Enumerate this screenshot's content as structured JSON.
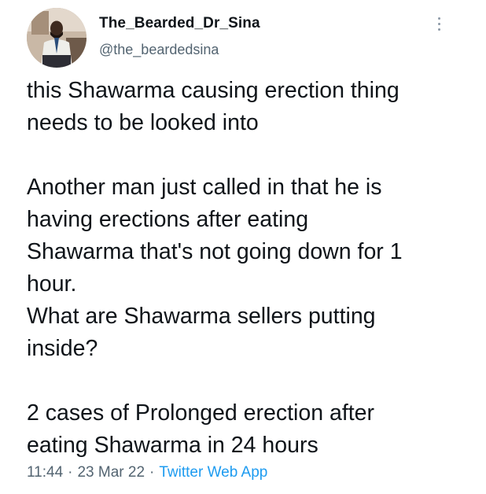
{
  "author": {
    "display_name": "The_Bearded_Dr_Sina",
    "handle": "@the_beardedsina"
  },
  "tweet": {
    "paragraphs": [
      [
        "this Shawarma causing erection thing",
        "needs to be looked into"
      ],
      [
        "Another man just called in that he is",
        "having erections after eating",
        "Shawarma that's not going down for 1",
        "hour.",
        "What are Shawarma sellers putting",
        "inside?"
      ],
      [
        "2 cases of Prolonged erection after",
        "eating Shawarma in 24 hours"
      ]
    ],
    "time": "11:44",
    "separator": "·",
    "date": "23 Mar 22",
    "source": "Twitter Web App"
  },
  "icons": {
    "more": "more-vertical-icon",
    "avatar": "avatar"
  },
  "colors": {
    "text": "#0f1419",
    "secondary": "#536471",
    "link": "#1d9bf0"
  }
}
